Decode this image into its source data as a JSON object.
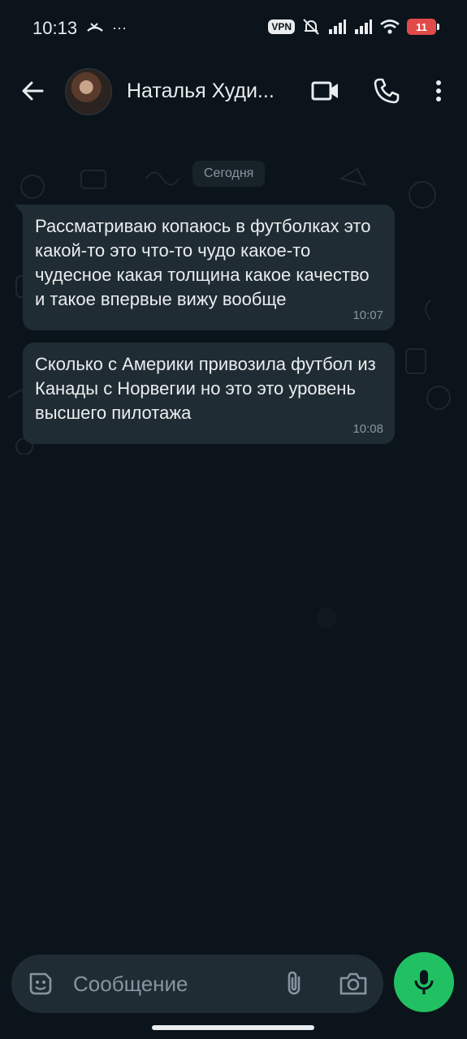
{
  "status_bar": {
    "time": "10:13",
    "vpn": "VPN",
    "battery": "11"
  },
  "header": {
    "contact_name": "Наталья Худи...",
    "icons": [
      "back-arrow-icon",
      "video-call-icon",
      "phone-icon",
      "more-vertical-icon"
    ]
  },
  "chat": {
    "date_label": "Сегодня",
    "messages": [
      {
        "text": "Рассматриваю копаюсь в футболках это какой-то это что-то чудо какое-то чудесное какая толщина какое качество и такое впервые вижу вообще",
        "time": "10:07"
      },
      {
        "text": "Сколько с Америки привозила футбол из Канады с Норвегии но это это уровень высшего пилотажа",
        "time": "10:08"
      }
    ]
  },
  "composer": {
    "placeholder": "Сообщение",
    "icons": [
      "sticker-icon",
      "attachment-icon",
      "camera-icon",
      "microphone-icon"
    ]
  },
  "colors": {
    "background": "#0b141a",
    "bubble": "#202c33",
    "accent": "#21c063"
  }
}
